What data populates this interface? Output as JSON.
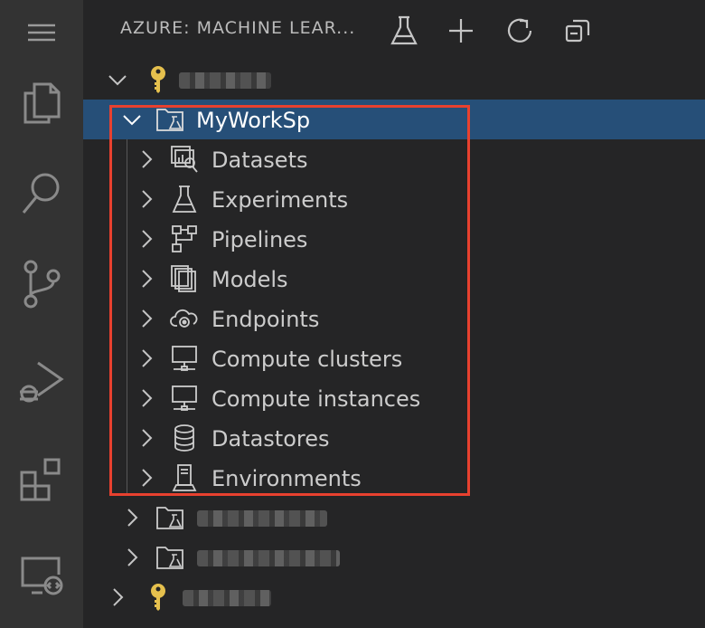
{
  "activity_bar": {
    "items": [
      {
        "name": "menu-icon"
      },
      {
        "name": "explorer-icon"
      },
      {
        "name": "search-icon"
      },
      {
        "name": "source-control-icon"
      },
      {
        "name": "run-debug-icon"
      },
      {
        "name": "extensions-icon"
      },
      {
        "name": "remote-explorer-icon"
      }
    ]
  },
  "header": {
    "title": "AZURE: MACHINE LEAR...",
    "actions": [
      "create-workspace-flask-icon",
      "add-icon",
      "refresh-icon",
      "collapse-all-icon"
    ]
  },
  "tree": {
    "subscription_1": {
      "label": "",
      "icon": "key-icon",
      "expanded": true
    },
    "workspace": {
      "label": "MyWorkSp",
      "icon": "workspace-folder-icon",
      "expanded": true,
      "selected": true
    },
    "children": [
      {
        "label": "Datasets",
        "icon": "datasets-icon"
      },
      {
        "label": "Experiments",
        "icon": "flask-icon"
      },
      {
        "label": "Pipelines",
        "icon": "pipeline-icon"
      },
      {
        "label": "Models",
        "icon": "models-icon"
      },
      {
        "label": "Endpoints",
        "icon": "cloud-endpoint-icon"
      },
      {
        "label": "Compute clusters",
        "icon": "compute-icon"
      },
      {
        "label": "Compute instances",
        "icon": "compute-icon"
      },
      {
        "label": "Datastores",
        "icon": "database-icon"
      },
      {
        "label": "Environments",
        "icon": "environment-icon"
      }
    ],
    "other_workspaces": [
      {
        "label": "",
        "icon": "workspace-folder-icon",
        "expanded": false
      },
      {
        "label": "",
        "icon": "workspace-folder-icon",
        "expanded": false
      }
    ],
    "subscription_2": {
      "label": "",
      "icon": "key-icon",
      "expanded": false
    }
  },
  "colors": {
    "activity_bar": "#333333",
    "sidebar": "#252526",
    "selection": "#264f78",
    "highlight_box": "#e8412f",
    "key": "#e5c04d"
  }
}
